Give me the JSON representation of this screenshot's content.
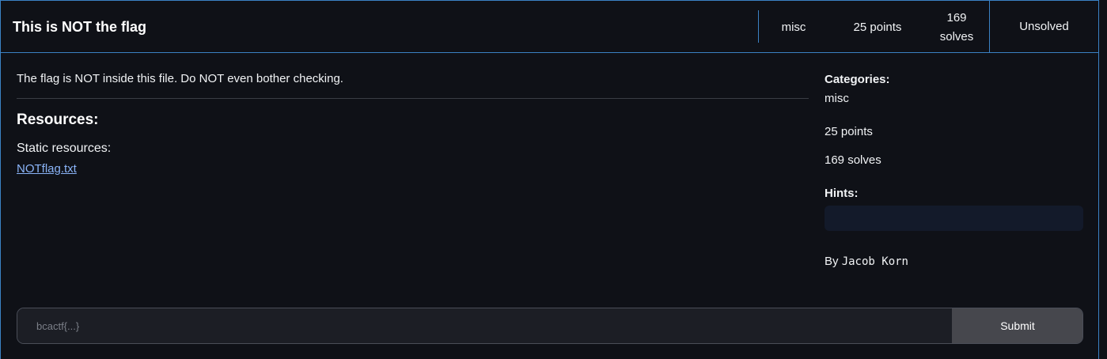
{
  "challenge": {
    "title": "This is NOT the flag",
    "category": "misc",
    "points": "25 points",
    "solves_count": "169",
    "solves_word": "solves",
    "status": "Unsolved"
  },
  "main": {
    "description": "The flag is NOT inside this file. Do NOT even bother checking.",
    "resources_heading": "Resources:",
    "static_label": "Static resources:",
    "file_link": "NOTflag.txt"
  },
  "sidebar": {
    "categories_label": "Categories:",
    "categories_value": "misc",
    "points": "25 points",
    "solves": "169 solves",
    "hints_label": "Hints:",
    "author_prefix": "By",
    "author_name": "Jacob Korn"
  },
  "form": {
    "placeholder": "bcactf{...}",
    "submit_label": "Submit"
  },
  "colors": {
    "background": "#0f1117",
    "accent_border": "#3b82c4",
    "link": "#8ab4f8",
    "submit_bg": "#46474d"
  }
}
